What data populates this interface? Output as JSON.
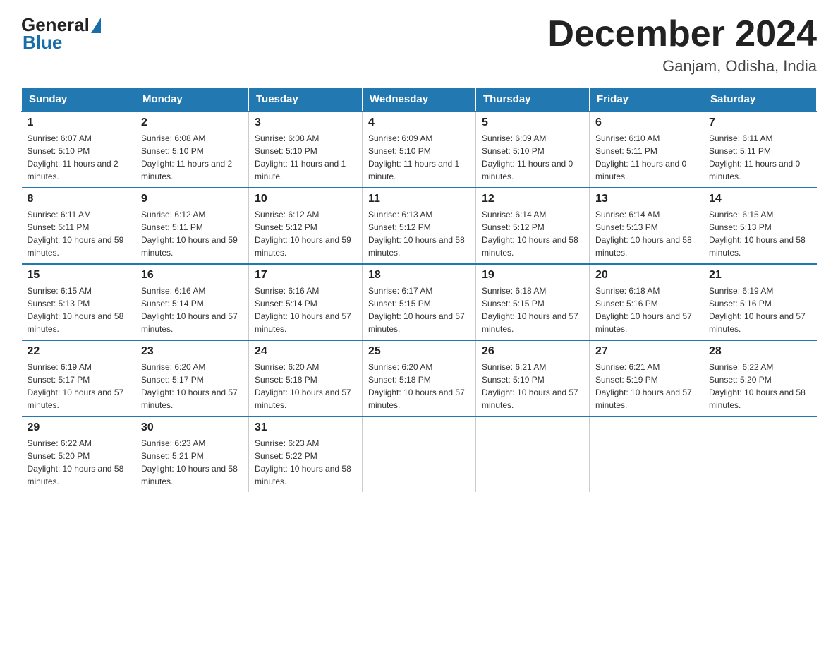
{
  "header": {
    "logo_general": "General",
    "logo_blue": "Blue",
    "title": "December 2024",
    "subtitle": "Ganjam, Odisha, India"
  },
  "weekdays": [
    "Sunday",
    "Monday",
    "Tuesday",
    "Wednesday",
    "Thursday",
    "Friday",
    "Saturday"
  ],
  "weeks": [
    [
      {
        "day": "1",
        "sunrise": "6:07 AM",
        "sunset": "5:10 PM",
        "daylight": "11 hours and 2 minutes."
      },
      {
        "day": "2",
        "sunrise": "6:08 AM",
        "sunset": "5:10 PM",
        "daylight": "11 hours and 2 minutes."
      },
      {
        "day": "3",
        "sunrise": "6:08 AM",
        "sunset": "5:10 PM",
        "daylight": "11 hours and 1 minute."
      },
      {
        "day": "4",
        "sunrise": "6:09 AM",
        "sunset": "5:10 PM",
        "daylight": "11 hours and 1 minute."
      },
      {
        "day": "5",
        "sunrise": "6:09 AM",
        "sunset": "5:10 PM",
        "daylight": "11 hours and 0 minutes."
      },
      {
        "day": "6",
        "sunrise": "6:10 AM",
        "sunset": "5:11 PM",
        "daylight": "11 hours and 0 minutes."
      },
      {
        "day": "7",
        "sunrise": "6:11 AM",
        "sunset": "5:11 PM",
        "daylight": "11 hours and 0 minutes."
      }
    ],
    [
      {
        "day": "8",
        "sunrise": "6:11 AM",
        "sunset": "5:11 PM",
        "daylight": "10 hours and 59 minutes."
      },
      {
        "day": "9",
        "sunrise": "6:12 AM",
        "sunset": "5:11 PM",
        "daylight": "10 hours and 59 minutes."
      },
      {
        "day": "10",
        "sunrise": "6:12 AM",
        "sunset": "5:12 PM",
        "daylight": "10 hours and 59 minutes."
      },
      {
        "day": "11",
        "sunrise": "6:13 AM",
        "sunset": "5:12 PM",
        "daylight": "10 hours and 58 minutes."
      },
      {
        "day": "12",
        "sunrise": "6:14 AM",
        "sunset": "5:12 PM",
        "daylight": "10 hours and 58 minutes."
      },
      {
        "day": "13",
        "sunrise": "6:14 AM",
        "sunset": "5:13 PM",
        "daylight": "10 hours and 58 minutes."
      },
      {
        "day": "14",
        "sunrise": "6:15 AM",
        "sunset": "5:13 PM",
        "daylight": "10 hours and 58 minutes."
      }
    ],
    [
      {
        "day": "15",
        "sunrise": "6:15 AM",
        "sunset": "5:13 PM",
        "daylight": "10 hours and 58 minutes."
      },
      {
        "day": "16",
        "sunrise": "6:16 AM",
        "sunset": "5:14 PM",
        "daylight": "10 hours and 57 minutes."
      },
      {
        "day": "17",
        "sunrise": "6:16 AM",
        "sunset": "5:14 PM",
        "daylight": "10 hours and 57 minutes."
      },
      {
        "day": "18",
        "sunrise": "6:17 AM",
        "sunset": "5:15 PM",
        "daylight": "10 hours and 57 minutes."
      },
      {
        "day": "19",
        "sunrise": "6:18 AM",
        "sunset": "5:15 PM",
        "daylight": "10 hours and 57 minutes."
      },
      {
        "day": "20",
        "sunrise": "6:18 AM",
        "sunset": "5:16 PM",
        "daylight": "10 hours and 57 minutes."
      },
      {
        "day": "21",
        "sunrise": "6:19 AM",
        "sunset": "5:16 PM",
        "daylight": "10 hours and 57 minutes."
      }
    ],
    [
      {
        "day": "22",
        "sunrise": "6:19 AM",
        "sunset": "5:17 PM",
        "daylight": "10 hours and 57 minutes."
      },
      {
        "day": "23",
        "sunrise": "6:20 AM",
        "sunset": "5:17 PM",
        "daylight": "10 hours and 57 minutes."
      },
      {
        "day": "24",
        "sunrise": "6:20 AM",
        "sunset": "5:18 PM",
        "daylight": "10 hours and 57 minutes."
      },
      {
        "day": "25",
        "sunrise": "6:20 AM",
        "sunset": "5:18 PM",
        "daylight": "10 hours and 57 minutes."
      },
      {
        "day": "26",
        "sunrise": "6:21 AM",
        "sunset": "5:19 PM",
        "daylight": "10 hours and 57 minutes."
      },
      {
        "day": "27",
        "sunrise": "6:21 AM",
        "sunset": "5:19 PM",
        "daylight": "10 hours and 57 minutes."
      },
      {
        "day": "28",
        "sunrise": "6:22 AM",
        "sunset": "5:20 PM",
        "daylight": "10 hours and 58 minutes."
      }
    ],
    [
      {
        "day": "29",
        "sunrise": "6:22 AM",
        "sunset": "5:20 PM",
        "daylight": "10 hours and 58 minutes."
      },
      {
        "day": "30",
        "sunrise": "6:23 AM",
        "sunset": "5:21 PM",
        "daylight": "10 hours and 58 minutes."
      },
      {
        "day": "31",
        "sunrise": "6:23 AM",
        "sunset": "5:22 PM",
        "daylight": "10 hours and 58 minutes."
      },
      null,
      null,
      null,
      null
    ]
  ]
}
